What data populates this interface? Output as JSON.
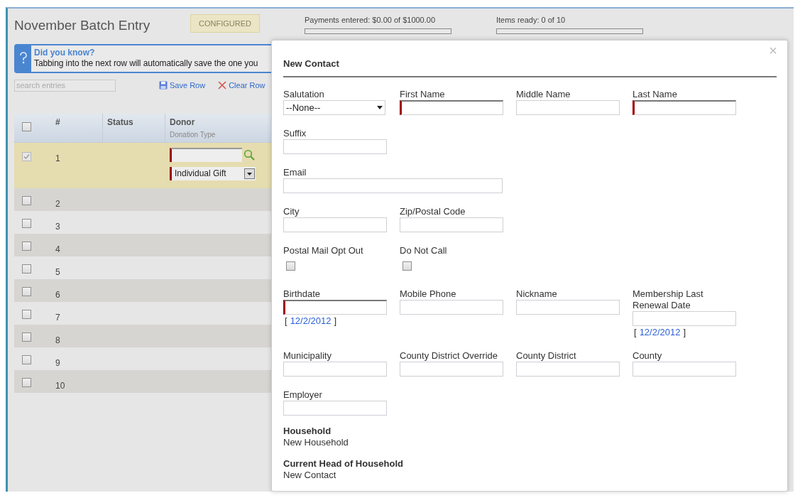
{
  "page": {
    "title": "November Batch Entry",
    "status_badge": "CONFIGURED",
    "progress": [
      {
        "label": "Payments entered: $0.00 of $1000.00",
        "level": 0
      },
      {
        "label": "Items ready: 0 of 10",
        "level": 0
      }
    ],
    "tip": {
      "title": "Did you know?",
      "text": "Tabbing into the next row will automatically save the one you"
    },
    "search": {
      "placeholder": "search entries"
    },
    "toolbar": [
      {
        "kind": "save",
        "label": "Save Row"
      },
      {
        "kind": "clear",
        "label": "Clear Row"
      }
    ],
    "table": {
      "header_checked": false,
      "columns": [
        {
          "label": "#"
        },
        {
          "label": "Status"
        },
        {
          "label": "Donor",
          "sublabel": "Donation Type"
        }
      ],
      "rows": [
        {
          "number": "1",
          "selected": true,
          "checked": true,
          "donation_type": "Individual Gift"
        },
        {
          "number": "2",
          "selected": false,
          "checked": false
        },
        {
          "number": "3",
          "selected": false,
          "checked": false
        },
        {
          "number": "4",
          "selected": false,
          "checked": false
        },
        {
          "number": "5",
          "selected": false,
          "checked": false
        },
        {
          "number": "6",
          "selected": false,
          "checked": false
        },
        {
          "number": "7",
          "selected": false,
          "checked": false
        },
        {
          "number": "8",
          "selected": false,
          "checked": false
        },
        {
          "number": "9",
          "selected": false,
          "checked": false
        },
        {
          "number": "10",
          "selected": false,
          "checked": false
        }
      ]
    }
  },
  "modal": {
    "title": "New Contact",
    "close": "×",
    "rows": [
      [
        {
          "label": "Salutation",
          "kind": "select",
          "value": "--None--"
        },
        {
          "label": "First Name",
          "kind": "text",
          "required": true
        },
        {
          "label": "Middle Name",
          "kind": "text",
          "required": false
        },
        {
          "label": "Last Name",
          "kind": "text",
          "required": true
        }
      ],
      [
        {
          "label": "Suffix",
          "kind": "text",
          "required": false
        }
      ],
      [
        {
          "label": "Email",
          "kind": "text",
          "required": false,
          "wide": true
        }
      ],
      [
        {
          "label": "City",
          "kind": "text",
          "required": false
        },
        {
          "label": "Zip/Postal Code",
          "kind": "text",
          "required": false
        }
      ],
      [
        {
          "label": "Postal Mail Opt Out",
          "kind": "checkbox",
          "checked": false
        },
        {
          "label": "Do Not Call",
          "kind": "checkbox",
          "checked": false
        }
      ],
      [
        {
          "label": "Birthdate",
          "kind": "date",
          "required": true,
          "link": {
            "open": "[",
            "date": "12/2/2012",
            "close": "]"
          }
        },
        {
          "label": "Mobile Phone",
          "kind": "text",
          "required": false
        },
        {
          "label": "Nickname",
          "kind": "text",
          "required": false
        },
        {
          "label": "Membership Last Renewal Date",
          "kind": "date",
          "required": false,
          "link": {
            "open": "[",
            "date": "12/2/2012",
            "close": "]"
          }
        }
      ],
      [
        {
          "label": "Municipality",
          "kind": "text",
          "required": false
        },
        {
          "label": "County District Override",
          "kind": "text",
          "required": false
        },
        {
          "label": "County District",
          "kind": "text",
          "required": false
        },
        {
          "label": "County",
          "kind": "text",
          "required": false
        }
      ],
      [
        {
          "label": "Employer",
          "kind": "text",
          "required": false
        }
      ]
    ],
    "info": [
      {
        "label": "Household",
        "value": "New Household"
      },
      {
        "label": "Current Head of Household",
        "value": "New Contact"
      }
    ]
  }
}
